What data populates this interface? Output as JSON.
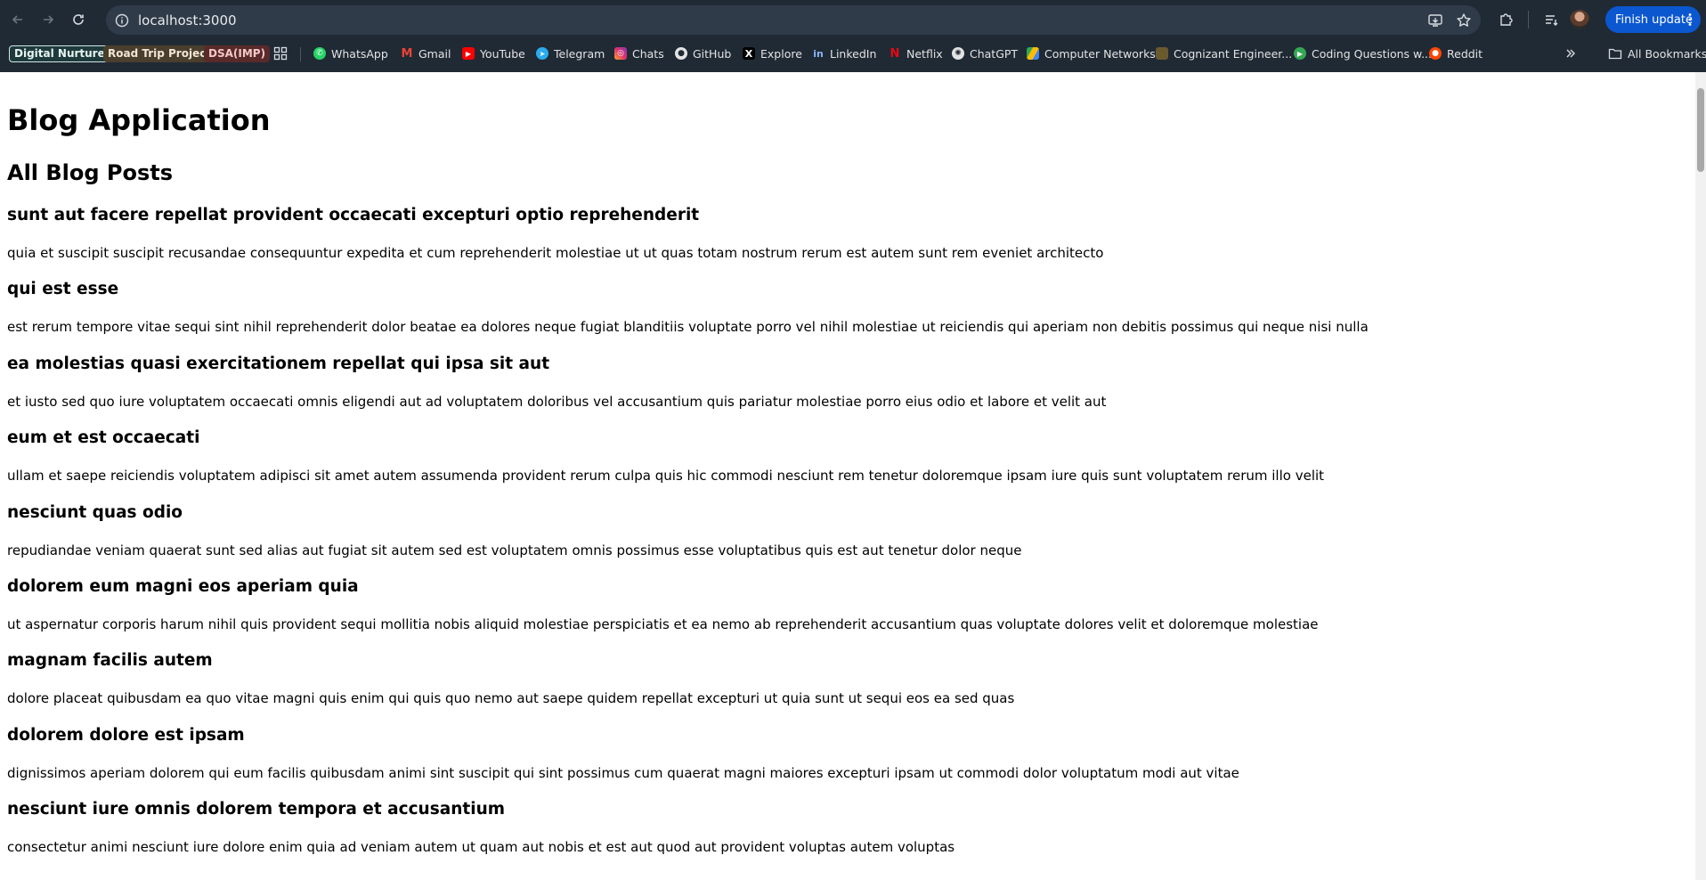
{
  "browser": {
    "url": "localhost:3000",
    "finish_update_label": "Finish update",
    "bookmarks": [
      {
        "label": "Digital Nurture",
        "icon": "pill"
      },
      {
        "label": "Road Trip Project",
        "icon": "pill"
      },
      {
        "label": "DSA(IMP)",
        "icon": "pill"
      },
      {
        "label": "WhatsApp",
        "icon": "whatsapp-icon"
      },
      {
        "label": "Gmail",
        "icon": "gmail-icon"
      },
      {
        "label": "YouTube",
        "icon": "youtube-icon"
      },
      {
        "label": "Telegram",
        "icon": "telegram-icon"
      },
      {
        "label": "Chats",
        "icon": "instagram-icon"
      },
      {
        "label": "GitHub",
        "icon": "github-icon"
      },
      {
        "label": "Explore",
        "icon": "x-icon"
      },
      {
        "label": "LinkedIn",
        "icon": "linkedin-icon"
      },
      {
        "label": "Netflix",
        "icon": "netflix-icon"
      },
      {
        "label": "ChatGPT",
        "icon": "chatgpt-icon"
      },
      {
        "label": "Computer Networks",
        "icon": "drive-icon"
      },
      {
        "label": "Cognizant Engineer...",
        "icon": "cognizant-icon"
      },
      {
        "label": "Coding Questions w...",
        "icon": "coding-icon"
      },
      {
        "label": "Reddit",
        "icon": "reddit-icon"
      }
    ],
    "all_bookmarks_label": "All Bookmarks"
  },
  "page": {
    "heading": "Blog Application",
    "subheading": "All Blog Posts",
    "posts": [
      {
        "title": "sunt aut facere repellat provident occaecati excepturi optio reprehenderit",
        "body": "quia et suscipit suscipit recusandae consequuntur expedita et cum reprehenderit molestiae ut ut quas totam nostrum rerum est autem sunt rem eveniet architecto"
      },
      {
        "title": "qui est esse",
        "body": "est rerum tempore vitae sequi sint nihil reprehenderit dolor beatae ea dolores neque fugiat blanditiis voluptate porro vel nihil molestiae ut reiciendis qui aperiam non debitis possimus qui neque nisi nulla"
      },
      {
        "title": "ea molestias quasi exercitationem repellat qui ipsa sit aut",
        "body": "et iusto sed quo iure voluptatem occaecati omnis eligendi aut ad voluptatem doloribus vel accusantium quis pariatur molestiae porro eius odio et labore et velit aut"
      },
      {
        "title": "eum et est occaecati",
        "body": "ullam et saepe reiciendis voluptatem adipisci sit amet autem assumenda provident rerum culpa quis hic commodi nesciunt rem tenetur doloremque ipsam iure quis sunt voluptatem rerum illo velit"
      },
      {
        "title": "nesciunt quas odio",
        "body": "repudiandae veniam quaerat sunt sed alias aut fugiat sit autem sed est voluptatem omnis possimus esse voluptatibus quis est aut tenetur dolor neque"
      },
      {
        "title": "dolorem eum magni eos aperiam quia",
        "body": "ut aspernatur corporis harum nihil quis provident sequi mollitia nobis aliquid molestiae perspiciatis et ea nemo ab reprehenderit accusantium quas voluptate dolores velit et doloremque molestiae"
      },
      {
        "title": "magnam facilis autem",
        "body": "dolore placeat quibusdam ea quo vitae magni quis enim qui quis quo nemo aut saepe quidem repellat excepturi ut quia sunt ut sequi eos ea sed quas"
      },
      {
        "title": "dolorem dolore est ipsam",
        "body": "dignissimos aperiam dolorem qui eum facilis quibusdam animi sint suscipit qui sint possimus cum quaerat magni maiores excepturi ipsam ut commodi dolor voluptatum modi aut vitae"
      },
      {
        "title": "nesciunt iure omnis dolorem tempora et accusantium",
        "body": "consectetur animi nesciunt iure dolore enim quia ad veniam autem ut quam aut nobis et est aut quod aut provident voluptas autem voluptas"
      }
    ]
  }
}
